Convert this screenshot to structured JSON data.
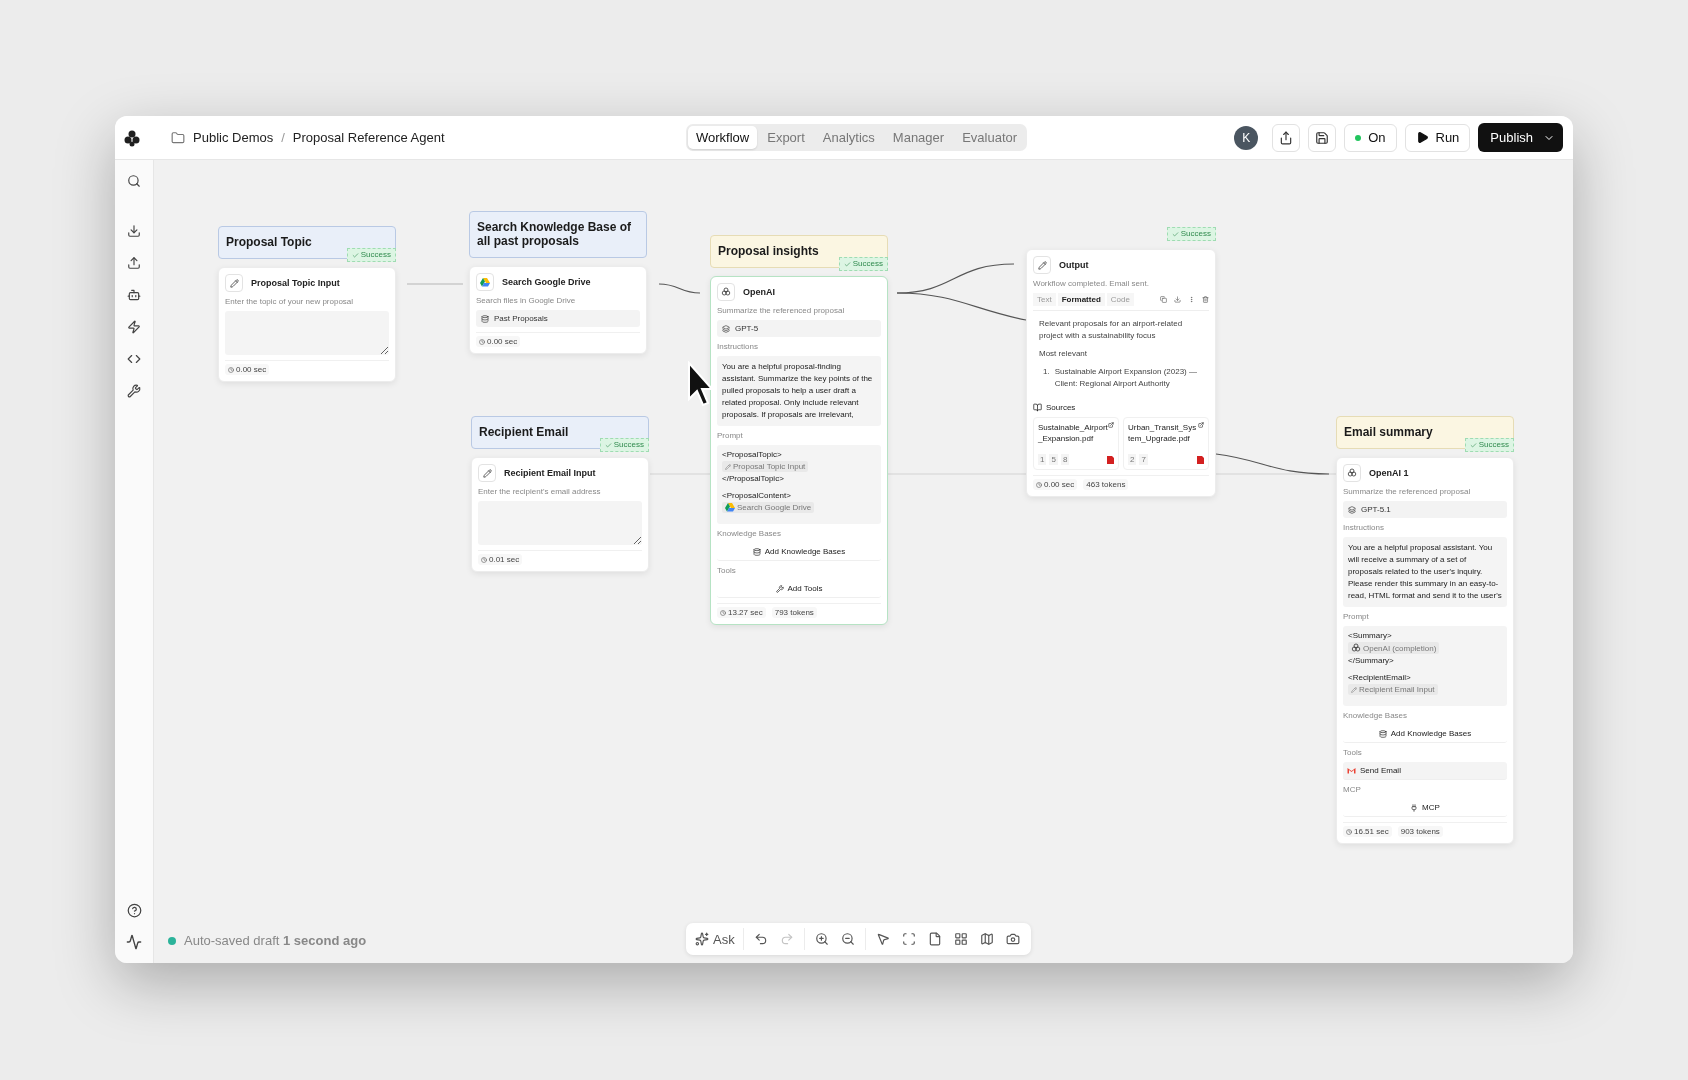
{
  "topbar": {
    "breadcrumb": [
      "Public Demos",
      "Proposal Reference Agent"
    ],
    "separator": "/",
    "tabs": [
      {
        "label": "Workflow",
        "selected": true
      },
      {
        "label": "Export",
        "selected": false
      },
      {
        "label": "Analytics",
        "selected": false
      },
      {
        "label": "Manager",
        "selected": false
      },
      {
        "label": "Evaluator",
        "selected": false
      }
    ],
    "avatar": "K",
    "toggle": {
      "label": "On",
      "on": true
    },
    "run": "Run",
    "publish": "Publish"
  },
  "nodes": [
    {
      "kind": "input",
      "title": "Proposal Topic",
      "status": "Success",
      "selected": false,
      "component": "Proposal Topic Input",
      "description": "Enter the topic of your new proposal",
      "time": "0.00 sec"
    },
    {
      "kind": "tool",
      "title": "Search Knowledge Base of all past proposals",
      "selected": false,
      "component": "Search Google Drive",
      "description": "Search files in Google Drive",
      "item": "Past Proposals",
      "time": "0.00 sec"
    },
    {
      "kind": "input",
      "title": "Recipient Email",
      "status": "Success",
      "selected": false,
      "component": "Recipient Email Input",
      "description": "Enter the recipient's email address",
      "time": "0.01 sec"
    },
    {
      "kind": "llm",
      "title": "Proposal insights",
      "status": "Success",
      "selected": true,
      "component": "OpenAI",
      "description": "Summarize the referenced proposal",
      "model": "GPT-5",
      "instructions_label": "Instructions",
      "instructions": "You are a helpful proposal-finding assistant. Summarize the key points of the pulled proposals to help a user draft a related proposal. Only include relevant proposals. If proposals are irrelevant,",
      "prompt_label": "Prompt",
      "prompt": [
        {
          "open": "<ProposalTopic>",
          "chip": "Proposal Topic Input",
          "kind": "input",
          "close": "</ProposalTopic>"
        },
        {
          "open": "<ProposalContent>",
          "chip": "Search Google Drive",
          "kind": "tool"
        }
      ],
      "sections": [
        {
          "kind": "knowledge",
          "label": "Knowledge Bases",
          "text": "Add Knowledge Bases"
        },
        {
          "kind": "tools",
          "label": "Tools",
          "text": "Add Tools"
        }
      ],
      "time": "13.27 sec",
      "tokens": "793 tokens"
    },
    {
      "kind": "output",
      "status": "Success",
      "selected": false,
      "component": "Output",
      "description": "Workflow completed. Email sent.",
      "view_tabs": [
        {
          "label": "Text",
          "selected": false
        },
        {
          "label": "Formatted",
          "selected": true
        },
        {
          "label": "Code",
          "selected": false
        }
      ],
      "content": [
        {
          "kind": "paragraph",
          "text": "Relevant proposals for an airport-related project with a sustainability focus"
        },
        {
          "kind": "paragraph",
          "text": "Most relevant"
        },
        {
          "kind": "list_item",
          "number": "1.",
          "text": "Sustainable Airport Expansion (2023) — Client: Regional Airport Authority"
        }
      ],
      "sources_label": "Sources",
      "sources": [
        {
          "name": "Sustainable_Airport_Expansion.pdf",
          "pages": [
            "1",
            "5",
            "8"
          ]
        },
        {
          "name": "Urban_Transit_System_Upgrade.pdf",
          "pages": [
            "2",
            "7"
          ]
        }
      ],
      "time": "0.00 sec",
      "tokens": "463 tokens"
    },
    {
      "kind": "llm",
      "title": "Email summary",
      "status": "Success",
      "selected": false,
      "component": "OpenAI 1",
      "description": "Summarize the referenced proposal",
      "model": "GPT-5.1",
      "instructions_label": "Instructions",
      "instructions": "You are a helpful proposal assistant. You will receive a summary of a set of proposals related to the user's inquiry. Please render this summary in an easy-to-read, HTML format and send it to the user's",
      "prompt_label": "Prompt",
      "prompt": [
        {
          "open": "<Summary>",
          "chip": "OpenAI (completion)",
          "kind": "llm",
          "close": "</Summary>"
        },
        {
          "open": "<RecipientEmail>",
          "chip": "Recipient Email Input",
          "kind": "input"
        }
      ],
      "sections": [
        {
          "kind": "knowledge",
          "label": "Knowledge Bases",
          "text": "Add Knowledge Bases"
        },
        {
          "kind": "tool_item",
          "label": "Tools",
          "text": "Send Email"
        },
        {
          "kind": "mcp",
          "label": "MCP",
          "text": "MCP"
        }
      ],
      "time": "16.51 sec",
      "tokens": "903 tokens"
    }
  ],
  "status": {
    "text": "Auto-saved draft **1 second ago**"
  },
  "toolbar": {
    "ask": "Ask",
    "undo": {
      "disabled": false
    },
    "redo": {
      "disabled": true
    }
  }
}
